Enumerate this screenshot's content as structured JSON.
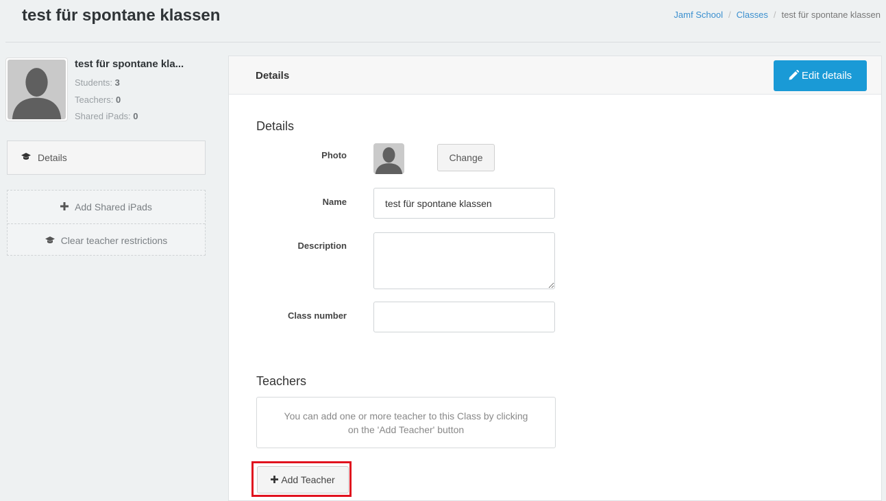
{
  "page": {
    "title": "test für spontane klassen"
  },
  "breadcrumb": {
    "items": [
      "Jamf School",
      "Classes",
      "test für spontane klassen"
    ]
  },
  "profile": {
    "name": "test für spontane kla...",
    "stats": [
      {
        "label": "Students:",
        "value": "3"
      },
      {
        "label": "Teachers:",
        "value": "0"
      },
      {
        "label": "Shared iPads:",
        "value": "0"
      }
    ]
  },
  "sidebar": {
    "nav": {
      "label": "Details",
      "icon": "graduation-cap-icon"
    },
    "actions": [
      {
        "label": "Add Shared iPads",
        "icon": "plus-icon"
      },
      {
        "label": "Clear teacher restrictions",
        "icon": "graduation-cap-icon"
      }
    ]
  },
  "panel": {
    "title": "Details",
    "edit_label": "Edit details",
    "edit_icon": "pencil-icon"
  },
  "details": {
    "section_title": "Details",
    "photo_label": "Photo",
    "change_label": "Change",
    "name_label": "Name",
    "name_value": "test für spontane klassen",
    "description_label": "Description",
    "description_value": "",
    "class_number_label": "Class number",
    "class_number_value": ""
  },
  "teachers": {
    "section_title": "Teachers",
    "empty_message": "You can add one or more teacher to this Class by clicking on the 'Add Teacher' button",
    "add_label": "Add Teacher",
    "add_icon": "plus-icon"
  },
  "colors": {
    "accent": "#1a9ad6",
    "highlight": "#e0111e"
  }
}
